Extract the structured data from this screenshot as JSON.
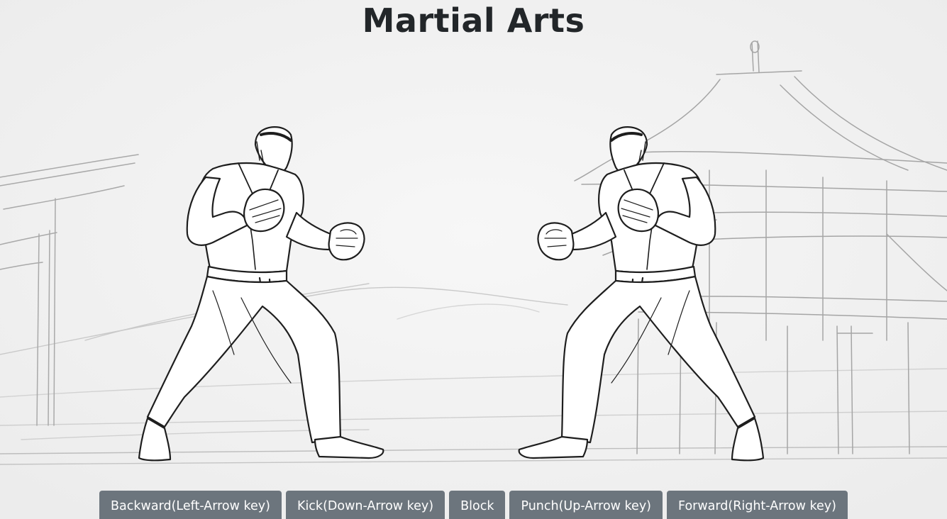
{
  "game": {
    "title": "Martial Arts"
  },
  "controls": [
    {
      "label": "Backward(Left-Arrow key)",
      "action": "backward"
    },
    {
      "label": "Kick(Down-Arrow key)",
      "action": "kick"
    },
    {
      "label": "Block",
      "action": "block"
    },
    {
      "label": "Punch(Up-Arrow key)",
      "action": "punch"
    },
    {
      "label": "Forward(Right-Arrow key)",
      "action": "forward"
    }
  ],
  "fighters": [
    {
      "id": "player",
      "pose": "fighting-stance",
      "facing": "right"
    },
    {
      "id": "opponent",
      "pose": "fighting-stance",
      "facing": "left"
    }
  ]
}
